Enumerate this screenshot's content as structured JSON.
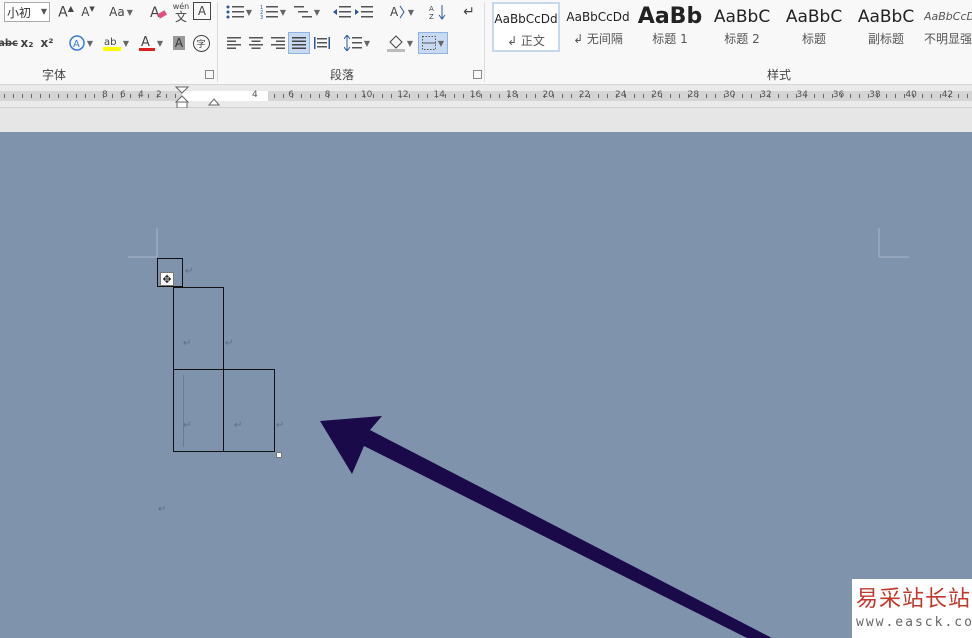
{
  "ribbon": {
    "font": {
      "size_value": "小初",
      "group_label": "字体",
      "pinyin_label": "wén",
      "pinyin_char": "文",
      "char_border_label": "A",
      "case_label": "Aa",
      "strike_label": "abc",
      "subscript_label": "x₂",
      "superscript_label": "x²",
      "enclose_label": "字",
      "font_color": "#e02020",
      "highlight_color": "#ffff00"
    },
    "paragraph": {
      "group_label": "段落"
    },
    "styles": {
      "group_label": "样式",
      "items": [
        {
          "sample": "AaBbCcDd",
          "name": "↲ 正文",
          "active": true
        },
        {
          "sample": "AaBbCcDd",
          "name": "↲ 无间隔"
        },
        {
          "sample": "AaBb",
          "name": "标题 1"
        },
        {
          "sample": "AaBbC",
          "name": "标题 2"
        },
        {
          "sample": "AaBbC",
          "name": "标题"
        },
        {
          "sample": "AaBbC",
          "name": "副标题"
        },
        {
          "sample": "AaBbCcDd",
          "name": "不明显强"
        }
      ]
    }
  },
  "ruler": {
    "left_numbers": [
      "8",
      "6",
      "4",
      "2"
    ],
    "right_numbers": [
      "4",
      "6",
      "8",
      "10",
      "12",
      "14",
      "16",
      "18",
      "20",
      "22",
      "24",
      "26",
      "28",
      "30",
      "32",
      "34",
      "36",
      "38",
      "40",
      "42"
    ]
  },
  "document": {
    "paragraph_mark": "↵",
    "background_color": "#8093ad",
    "arrow_color": "#1a0a4a"
  },
  "watermark": {
    "title": "易采站长站",
    "url": "www.easck.com"
  }
}
